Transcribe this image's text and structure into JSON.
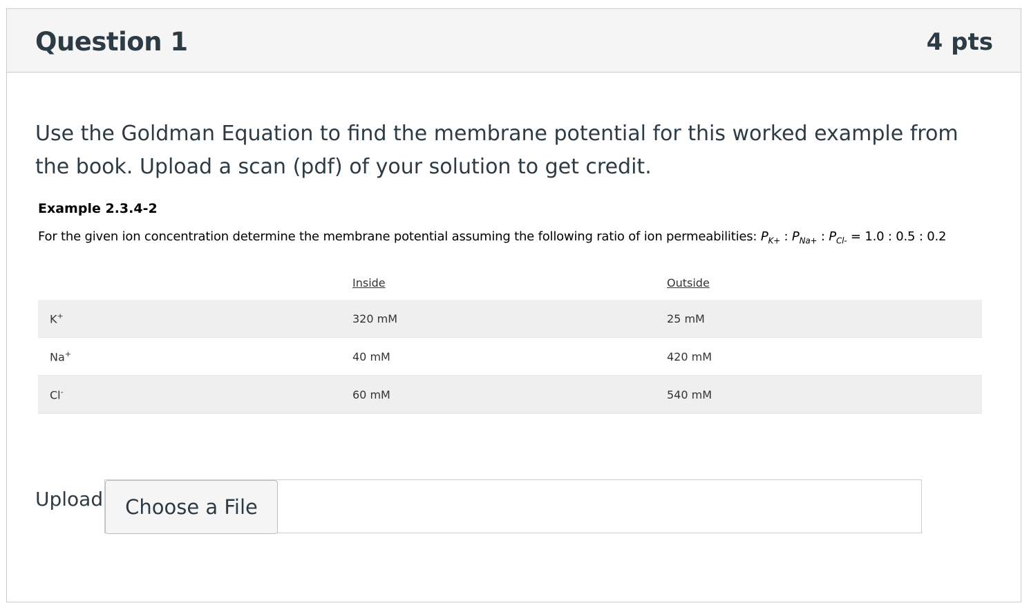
{
  "question": {
    "title": "Question 1",
    "points": "4 pts",
    "prompt": "Use the Goldman Equation to find the membrane potential for this worked example from the book.  Upload a scan (pdf) of your solution to get credit."
  },
  "example": {
    "title": "Example 2.3.4-2",
    "description_prefix": "For the given ion concentration determine the membrane potential assuming the following ratio of ion permeabilities: ",
    "perm_k": "P",
    "perm_k_sub": "K+",
    "perm_na": "P",
    "perm_na_sub": "Na+",
    "perm_cl": "P",
    "perm_cl_sub": "Cl-",
    "separator": " : ",
    "ratio": " = 1.0 : 0.5 : 0.2"
  },
  "table": {
    "headers": [
      "",
      "Inside",
      "Outside"
    ],
    "rows": [
      {
        "ion": "K",
        "charge": "+",
        "inside": "320 mM",
        "outside": "25 mM"
      },
      {
        "ion": "Na",
        "charge": "+",
        "inside": "40 mM",
        "outside": "420 mM"
      },
      {
        "ion": "Cl",
        "charge": "-",
        "inside": "60 mM",
        "outside": "540 mM"
      }
    ]
  },
  "upload": {
    "label": "Upload",
    "button_label": "Choose a File"
  }
}
